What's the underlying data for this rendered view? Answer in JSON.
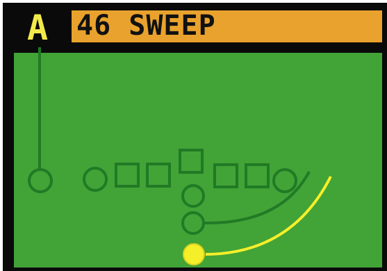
{
  "card": {
    "formation_letter": "A",
    "play_name": "46 SWEEP"
  },
  "colors": {
    "frame": "#0a0a0a",
    "title_bar": "#e9a22d",
    "title_text": "#111111",
    "formation_letter": "#f2ea4a",
    "field": "#42a337",
    "player_outline": "#217a25",
    "route_line": "#217a25",
    "ball_carrier": "#f5ef2a",
    "ball_carrier_route": "#f5ef2a"
  },
  "players": {
    "left_end_icon": "circle-icon",
    "lineman_icon": "square-icon",
    "center_icon": "square-icon",
    "back_icon": "circle-icon",
    "ball_carrier_icon": "filled-circle-icon"
  }
}
